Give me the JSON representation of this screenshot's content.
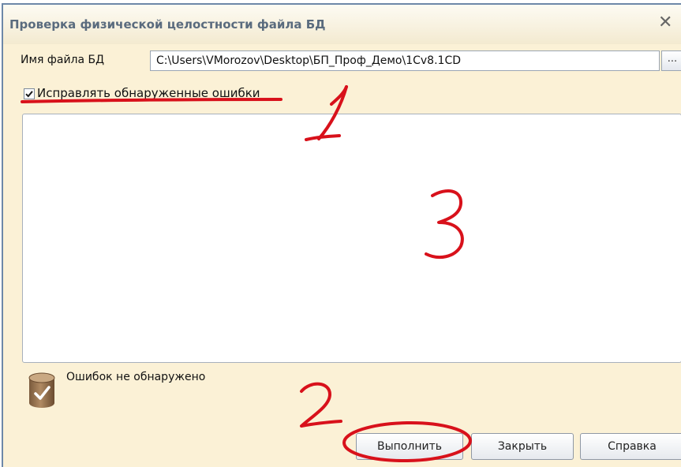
{
  "window": {
    "title": "Проверка физической целостности файла БД",
    "close_glyph": "✕"
  },
  "db_file": {
    "label": "Имя файла БД",
    "value": "C:\\Users\\VMorozov\\Desktop\\БП_Проф_Демо\\1Cv8.1CD",
    "browse_label": "..."
  },
  "fix_errors": {
    "label": "Исправлять обнаруженные ошибки",
    "checked": true
  },
  "status": {
    "text": "Ошибок не обнаружено",
    "icon": "database-check-icon"
  },
  "buttons": {
    "run": "Выполнить",
    "close": "Закрыть",
    "help": "Справка"
  },
  "annotations": {
    "marker_1": "1",
    "marker_2": "2",
    "marker_3": "3",
    "color": "#d8111b"
  }
}
